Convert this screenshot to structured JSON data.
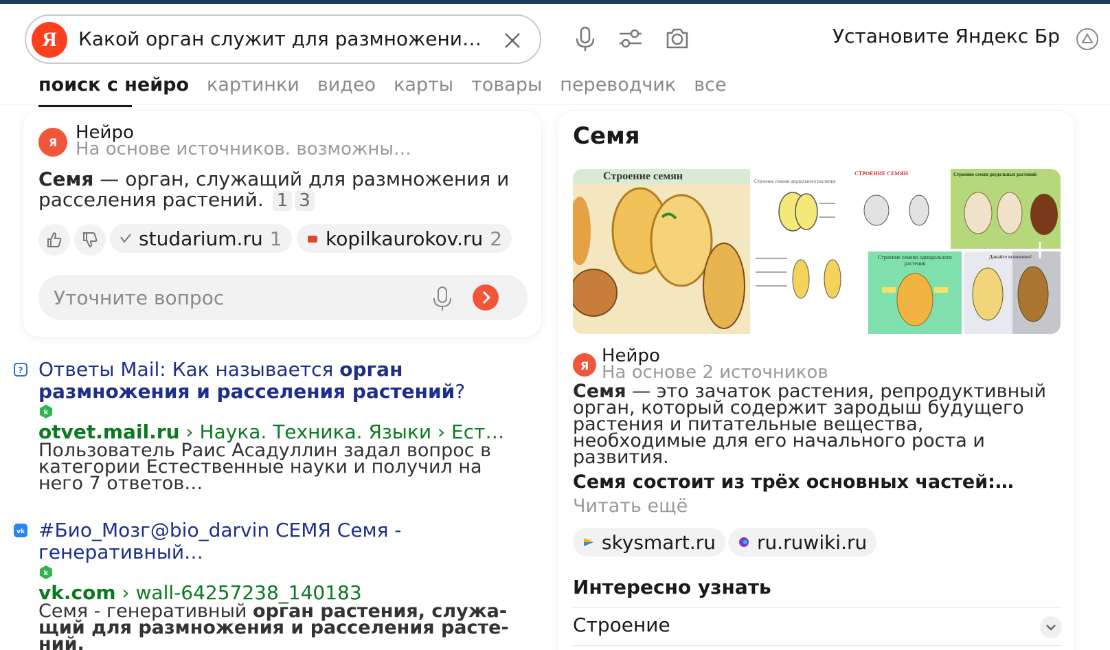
{
  "search": {
    "logo_letter": "Я",
    "query": "Какой орган служит для размножения…"
  },
  "header": {
    "install_text": "Установите Яндекс Бр"
  },
  "tabs": [
    {
      "label": "поиск с нейро",
      "active": true
    },
    {
      "label": "картинки",
      "active": false
    },
    {
      "label": "видео",
      "active": false
    },
    {
      "label": "карты",
      "active": false
    },
    {
      "label": "товары",
      "active": false
    },
    {
      "label": "переводчик",
      "active": false
    },
    {
      "label": "все",
      "active": false
    }
  ],
  "neuro_card": {
    "title": "Нейро",
    "subtitle": "На основе источников. возможны…",
    "answer_bold": "Семя",
    "answer_rest": " — орган, служащий для размножения и расселения растений.",
    "refs": [
      "1",
      "3"
    ],
    "sources": [
      {
        "name": "studarium.ru",
        "num": "1"
      },
      {
        "name": "kopilkaurokov.ru",
        "num": "2"
      }
    ],
    "refine_placeholder": "Уточните вопрос"
  },
  "results": [
    {
      "title_plain": "Ответы Mail: Как называется ",
      "title_bold": "орган размноже­ния и расселения растений",
      "title_tail": "?",
      "url_domain": "otvet.mail.ru",
      "url_path": " › Наука. Техника. Языки › Ест…",
      "snippet": "Пользователь Раис Асадуллин задал вопрос в категории Естественные науки и получил на него 7 ответов…"
    },
    {
      "title_plain": "#Био_Мозг@bio_darvin СЕМЯ Семя - генеративный…",
      "url_domain": "vk.com",
      "url_path": " › wall-64257238_140183",
      "snippet_plain": "Семя - генеративный ",
      "snippet_bold": "орган растения, служа­щий для размножения и расселения расте­ний."
    }
  ],
  "side_panel": {
    "title": "Семя",
    "images": [
      {
        "caption": "Строение семян"
      },
      {
        "caption": "Строение семени двудольного растения"
      },
      {
        "caption": "СТРОЕНИЕ СЕМЯН"
      },
      {
        "caption": "Строение семян двудольных растений"
      },
      {
        "caption": "Строение семени однодольного растения"
      },
      {
        "caption": "Давайте вспомним!"
      }
    ],
    "neuro_title": "Нейро",
    "neuro_subtitle": "На основе 2 источников",
    "answer_bold": "Семя",
    "answer_rest": " — это зачаток растения, репродуктивный орган, который содержит зародыш будущего растения и питательные вещества, необходимые для его начального роста и развития.",
    "parts_text": "Семя состоит из трёх основных частей:…",
    "read_more": "Читать ещё",
    "sources": [
      "skysmart.ru",
      "ru.ruwiki.ru"
    ],
    "interesting_title": "Интересно узнать",
    "faq": [
      {
        "label": "Строение"
      }
    ]
  },
  "colors": {
    "accent": "#fc3f1d",
    "link": "#1e2f8a",
    "url_green": "#0b7a1e"
  }
}
